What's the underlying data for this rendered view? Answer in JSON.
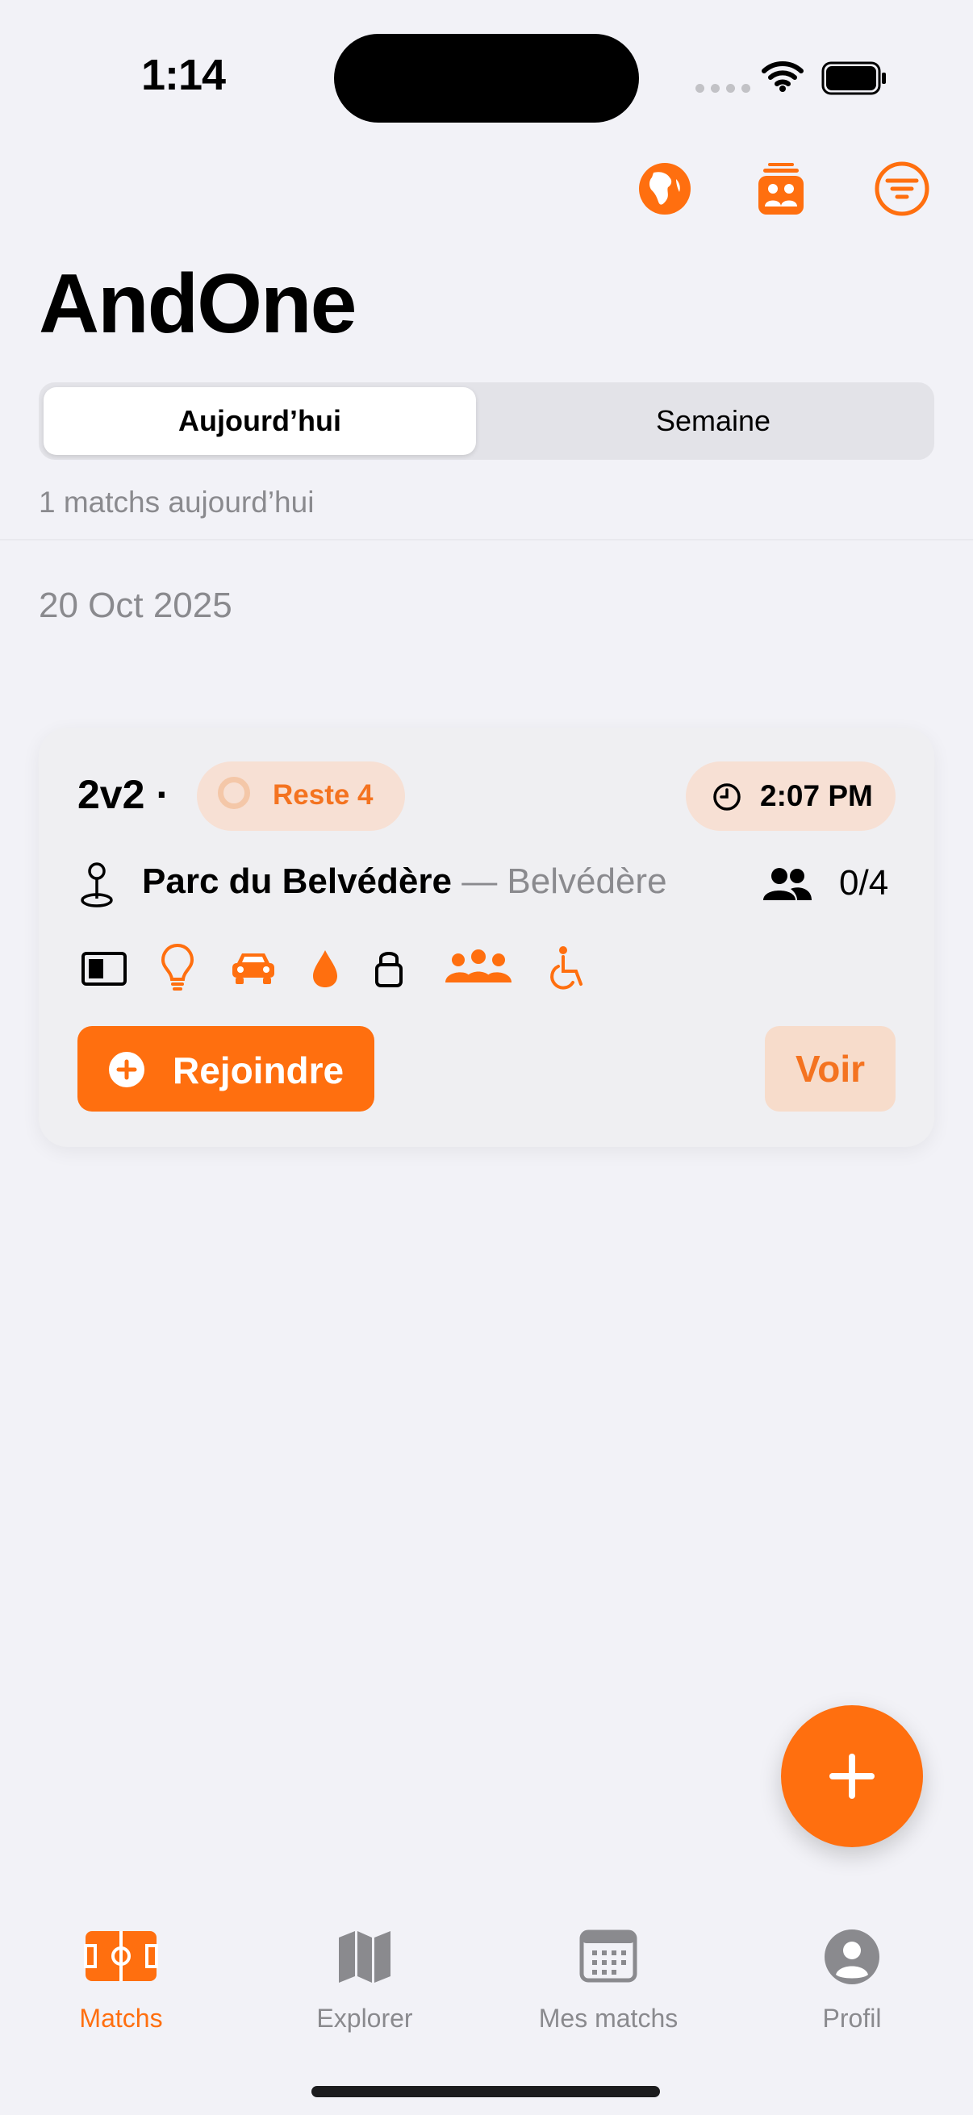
{
  "status_bar": {
    "time": "1:14"
  },
  "header": {
    "title": "AndOne",
    "icons": [
      "globe-africa-icon",
      "team-board-icon",
      "filter-icon"
    ]
  },
  "segmented": {
    "today": "Aujourd’hui",
    "week": "Semaine",
    "selected": "today"
  },
  "summary": {
    "count_text": "1 matchs aujourd’hui"
  },
  "section": {
    "date": "20 Oct 2025"
  },
  "match": {
    "format": "2v2 ·",
    "remaining": "Reste 4",
    "time": "2:07 PM",
    "venue": "Parc du Belvédère",
    "venue_sep": " — ",
    "area": "Belvédère",
    "players": "0/4",
    "amenities": [
      "court-surface-icon",
      "lightbulb-icon",
      "car-icon",
      "water-drop-icon",
      "lock-icon",
      "group-icon",
      "wheelchair-icon"
    ],
    "join_label": "Rejoindre",
    "view_label": "Voir"
  },
  "tabbar": {
    "items": [
      {
        "label": "Matchs",
        "icon": "court-icon",
        "active": true
      },
      {
        "label": "Explorer",
        "icon": "map-icon",
        "active": false
      },
      {
        "label": "Mes matchs",
        "icon": "calendar-icon",
        "active": false
      },
      {
        "label": "Profil",
        "icon": "person-circle-icon",
        "active": false
      }
    ]
  },
  "colors": {
    "accent": "#FF6F0F",
    "accent_soft": "#F7E0D4",
    "background": "#F2F2F7",
    "secondary_text": "#8A8A8E"
  }
}
